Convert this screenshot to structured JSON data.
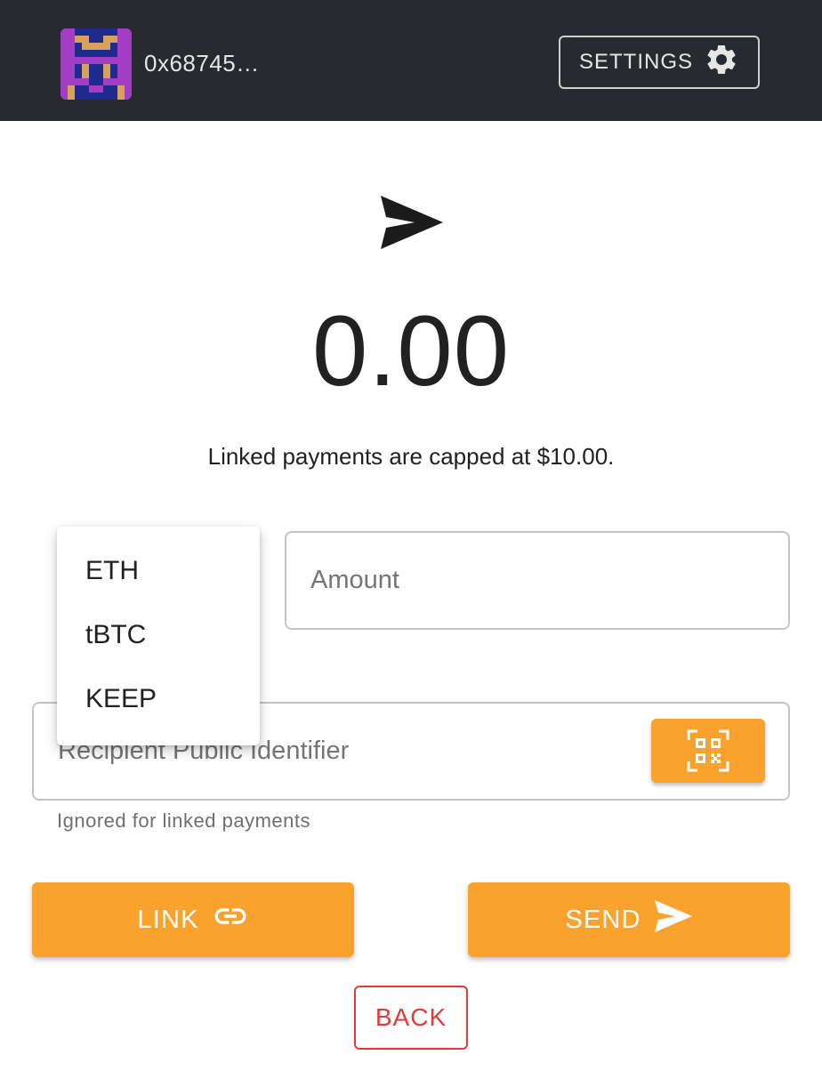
{
  "header": {
    "address": "0x68745…",
    "settings_label": "SETTINGS",
    "avatar_icon": "identicon",
    "settings_icon": "gear-icon"
  },
  "main": {
    "hero_icon": "send-icon",
    "amount_display": "0.00",
    "cap_note": "Linked payments are capped at $10.00."
  },
  "form": {
    "token_options": [
      "ETH",
      "tBTC",
      "KEEP"
    ],
    "amount_placeholder": "Amount",
    "recipient_placeholder": "Recipient Public Identifier",
    "recipient_helper": "Ignored for linked payments",
    "qr_icon": "qr-code-scan-icon"
  },
  "actions": {
    "link_label": "LINK",
    "link_icon": "link-icon",
    "send_label": "SEND",
    "send_icon": "send-icon",
    "back_label": "BACK"
  },
  "colors": {
    "header_bg": "#272a2e",
    "accent": "#f9a22e",
    "danger": "#e53935"
  }
}
